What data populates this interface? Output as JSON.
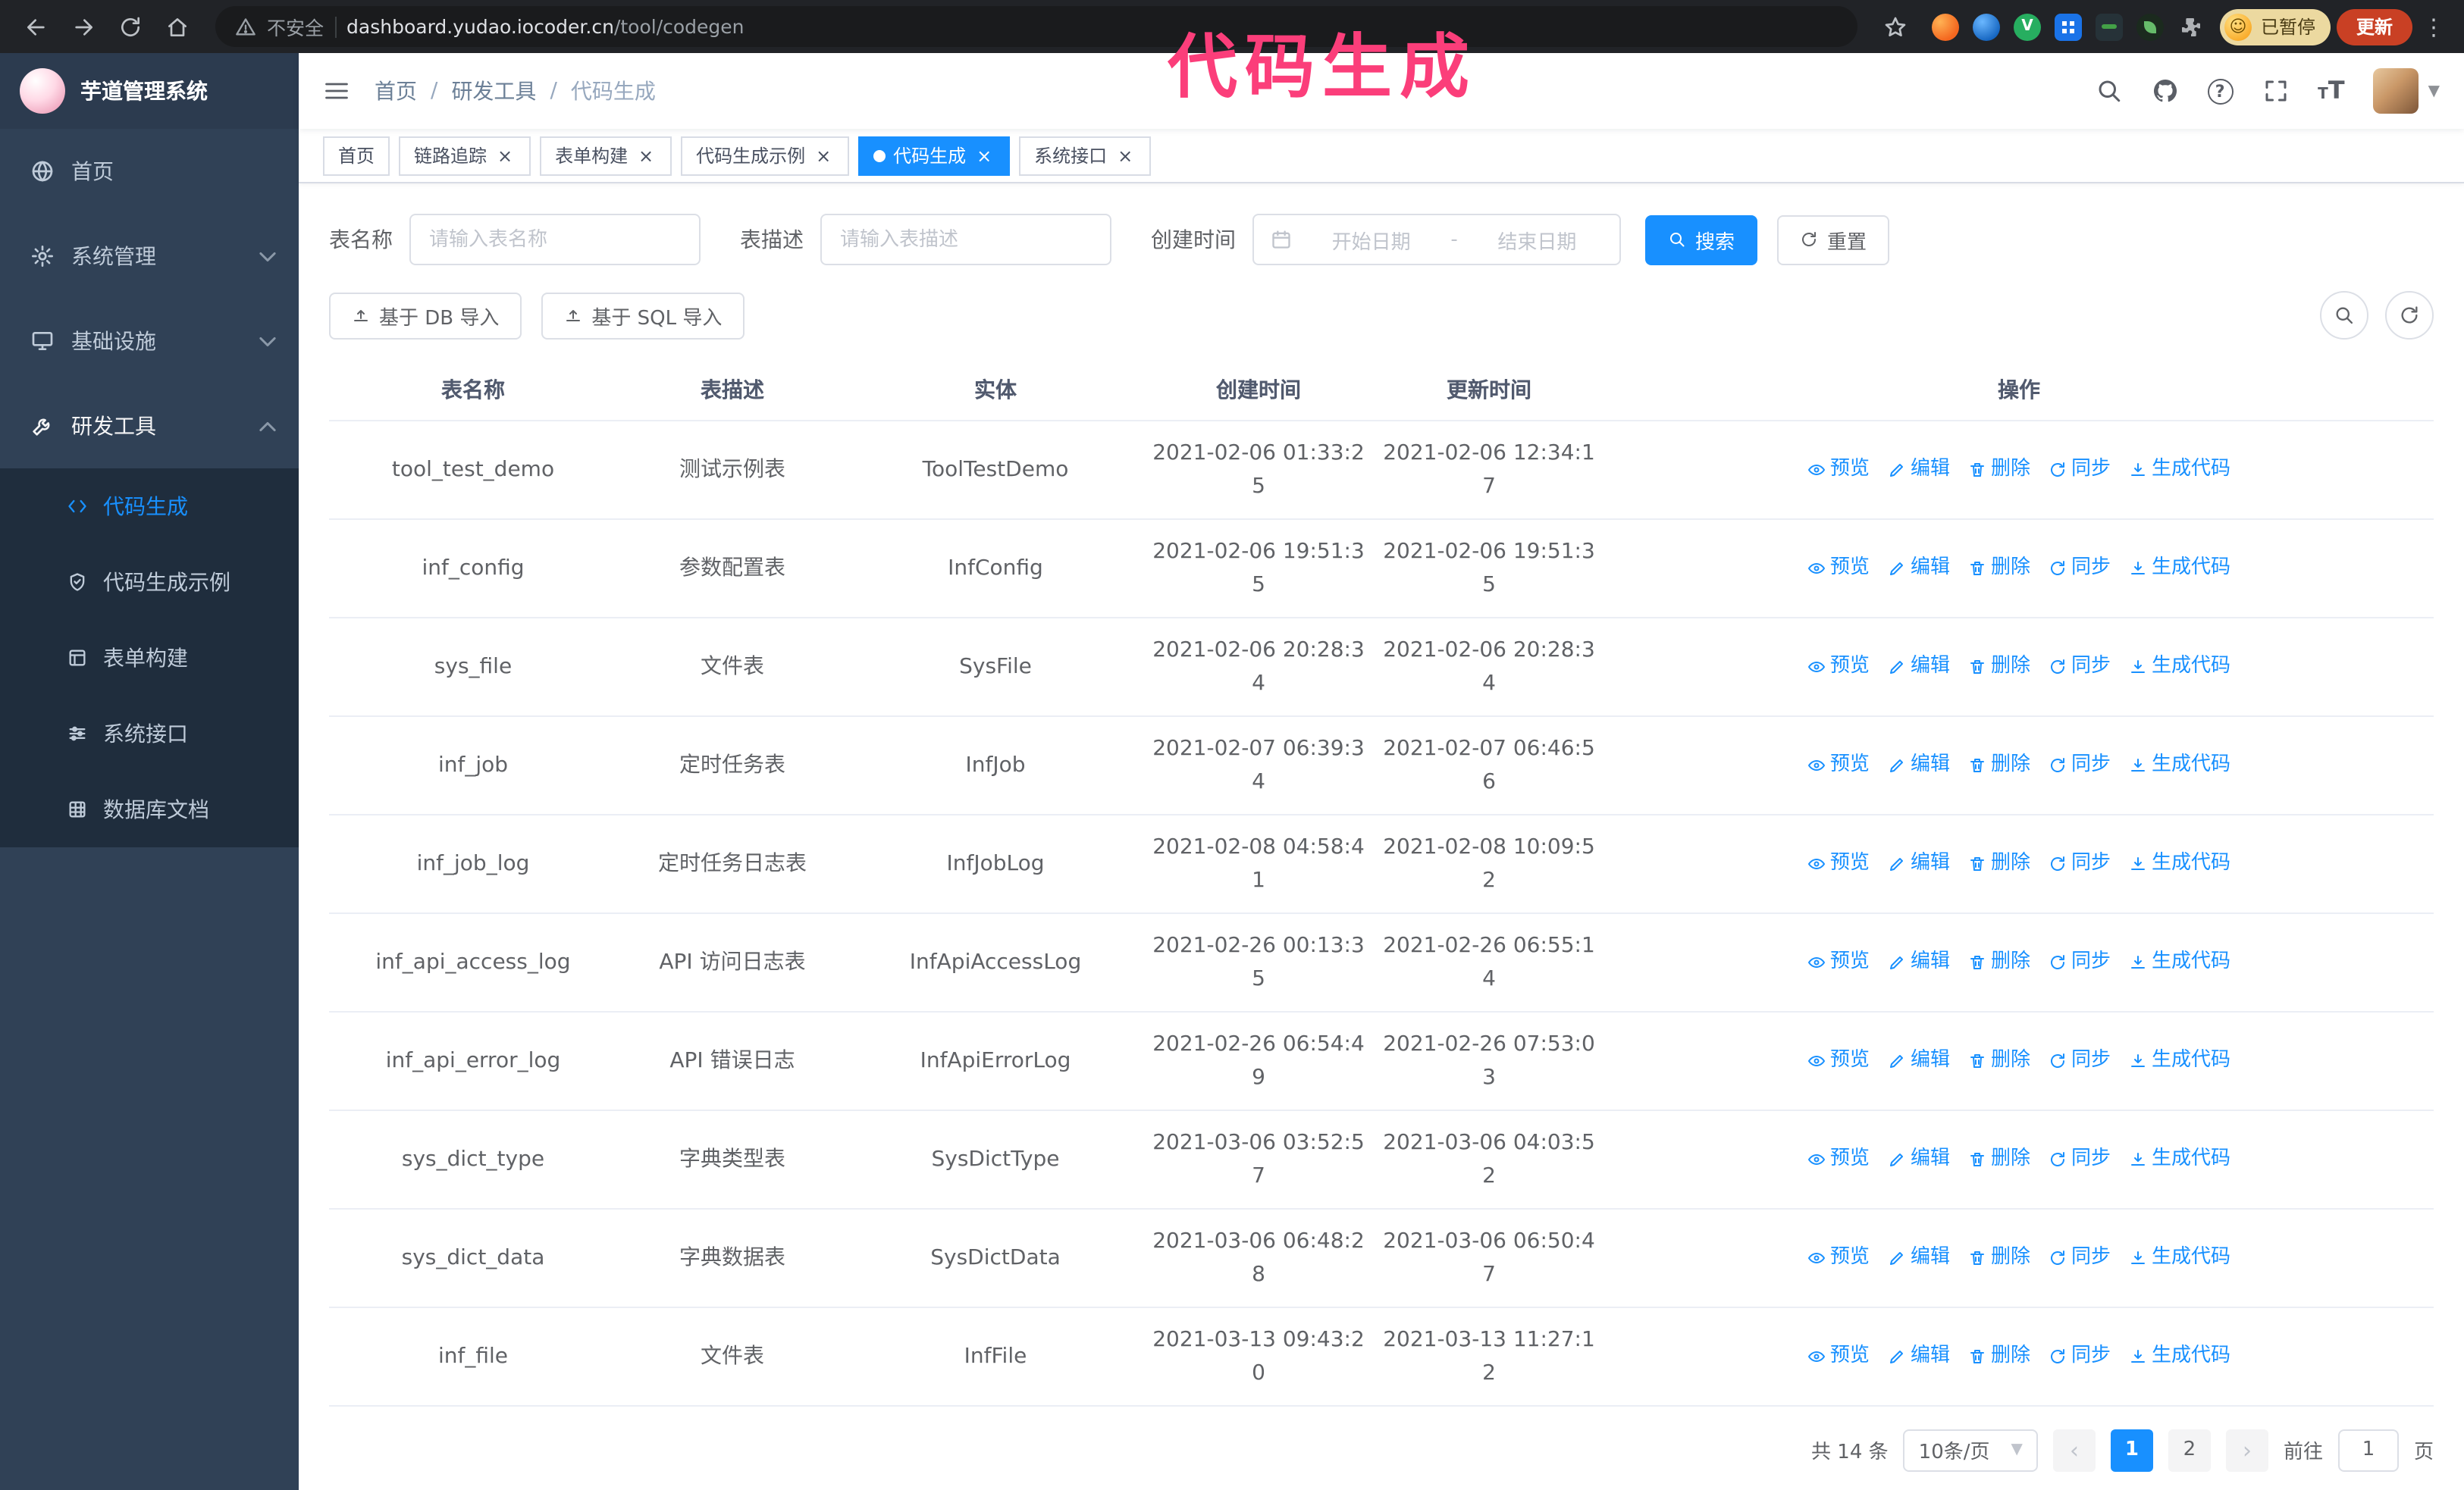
{
  "annotation": {
    "text": "代码生成"
  },
  "browser": {
    "security_label": "不安全",
    "url_host": "dashboard.yudao.iocoder.cn",
    "url_path": "/tool/codegen",
    "paused_badge": "已暂停",
    "update_button": "更新"
  },
  "sidebar": {
    "title": "芋道管理系统",
    "items": [
      {
        "label": "首页"
      },
      {
        "label": "系统管理"
      },
      {
        "label": "基础设施"
      },
      {
        "label": "研发工具"
      }
    ],
    "submenu": [
      {
        "label": "代码生成"
      },
      {
        "label": "代码生成示例"
      },
      {
        "label": "表单构建"
      },
      {
        "label": "系统接口"
      },
      {
        "label": "数据库文档"
      }
    ]
  },
  "navbar": {
    "breadcrumb": [
      "首页",
      "研发工具",
      "代码生成"
    ]
  },
  "tags": [
    {
      "label": "首页"
    },
    {
      "label": "链路追踪"
    },
    {
      "label": "表单构建"
    },
    {
      "label": "代码生成示例"
    },
    {
      "label": "代码生成"
    },
    {
      "label": "系统接口"
    }
  ],
  "search_form": {
    "table_name_label": "表名称",
    "table_name_placeholder": "请输入表名称",
    "table_desc_label": "表描述",
    "table_desc_placeholder": "请输入表描述",
    "create_time_label": "创建时间",
    "date_start_placeholder": "开始日期",
    "date_separator": "-",
    "date_end_placeholder": "结束日期",
    "search_button": "搜索",
    "reset_button": "重置"
  },
  "toolbar": {
    "import_db_button": "基于 DB 导入",
    "import_sql_button": "基于 SQL 导入"
  },
  "table": {
    "columns": [
      "表名称",
      "表描述",
      "实体",
      "创建时间",
      "更新时间",
      "操作"
    ],
    "actions": [
      "预览",
      "编辑",
      "删除",
      "同步",
      "生成代码"
    ],
    "rows": [
      {
        "name": "tool_test_demo",
        "desc": "测试示例表",
        "entity": "ToolTestDemo",
        "create_time": "2021-02-06 01:33:25",
        "update_time": "2021-02-06 12:34:17"
      },
      {
        "name": "inf_config",
        "desc": "参数配置表",
        "entity": "InfConfig",
        "create_time": "2021-02-06 19:51:35",
        "update_time": "2021-02-06 19:51:35"
      },
      {
        "name": "sys_file",
        "desc": "文件表",
        "entity": "SysFile",
        "create_time": "2021-02-06 20:28:34",
        "update_time": "2021-02-06 20:28:34"
      },
      {
        "name": "inf_job",
        "desc": "定时任务表",
        "entity": "InfJob",
        "create_time": "2021-02-07 06:39:34",
        "update_time": "2021-02-07 06:46:56"
      },
      {
        "name": "inf_job_log",
        "desc": "定时任务日志表",
        "entity": "InfJobLog",
        "create_time": "2021-02-08 04:58:41",
        "update_time": "2021-02-08 10:09:52"
      },
      {
        "name": "inf_api_access_log",
        "desc": "API 访问日志表",
        "entity": "InfApiAccessLog",
        "create_time": "2021-02-26 00:13:35",
        "update_time": "2021-02-26 06:55:14"
      },
      {
        "name": "inf_api_error_log",
        "desc": "API 错误日志",
        "entity": "InfApiErrorLog",
        "create_time": "2021-02-26 06:54:49",
        "update_time": "2021-02-26 07:53:03"
      },
      {
        "name": "sys_dict_type",
        "desc": "字典类型表",
        "entity": "SysDictType",
        "create_time": "2021-03-06 03:52:57",
        "update_time": "2021-03-06 04:03:52"
      },
      {
        "name": "sys_dict_data",
        "desc": "字典数据表",
        "entity": "SysDictData",
        "create_time": "2021-03-06 06:48:28",
        "update_time": "2021-03-06 06:50:47"
      },
      {
        "name": "inf_file",
        "desc": "文件表",
        "entity": "InfFile",
        "create_time": "2021-03-13 09:43:20",
        "update_time": "2021-03-13 11:27:12"
      }
    ]
  },
  "pagination": {
    "total_text": "共 14 条",
    "page_size": "10条/页",
    "pages": [
      "1",
      "2"
    ],
    "goto_label": "前往",
    "goto_value": "1",
    "goto_suffix": "页"
  },
  "colors": {
    "accent": "#1890ff",
    "sidebar_bg": "#304156",
    "submenu_bg": "#1f2d3d",
    "annotation": "#fb3e7a"
  }
}
